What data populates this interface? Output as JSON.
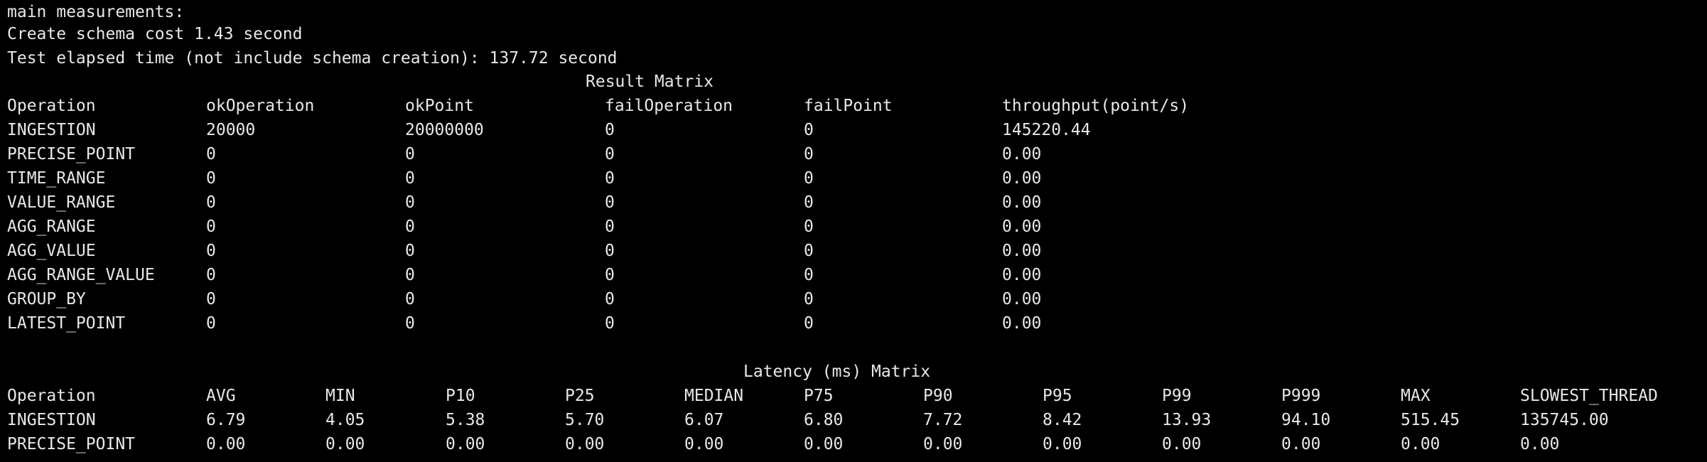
{
  "colors": {
    "background": "#000000",
    "text": "#e8e8e8"
  },
  "header": {
    "line1": "main measurements:",
    "line2": "Create schema cost 1.43 second",
    "line3": "Test elapsed time (not include schema creation): 137.72 second"
  },
  "result_matrix": {
    "title": "Result Matrix",
    "headers": [
      "Operation",
      "okOperation",
      "okPoint",
      "failOperation",
      "failPoint",
      "throughput(point/s)"
    ],
    "rows": [
      [
        "INGESTION",
        "20000",
        "20000000",
        "0",
        "0",
        "145220.44"
      ],
      [
        "PRECISE_POINT",
        "0",
        "0",
        "0",
        "0",
        "0.00"
      ],
      [
        "TIME_RANGE",
        "0",
        "0",
        "0",
        "0",
        "0.00"
      ],
      [
        "VALUE_RANGE",
        "0",
        "0",
        "0",
        "0",
        "0.00"
      ],
      [
        "AGG_RANGE",
        "0",
        "0",
        "0",
        "0",
        "0.00"
      ],
      [
        "AGG_VALUE",
        "0",
        "0",
        "0",
        "0",
        "0.00"
      ],
      [
        "AGG_RANGE_VALUE",
        "0",
        "0",
        "0",
        "0",
        "0.00"
      ],
      [
        "GROUP_BY",
        "0",
        "0",
        "0",
        "0",
        "0.00"
      ],
      [
        "LATEST_POINT",
        "0",
        "0",
        "0",
        "0",
        "0.00"
      ]
    ]
  },
  "latency_matrix": {
    "title": "Latency (ms) Matrix",
    "headers": [
      "Operation",
      "AVG",
      "MIN",
      "P10",
      "P25",
      "MEDIAN",
      "P75",
      "P90",
      "P95",
      "P99",
      "P999",
      "MAX",
      "SLOWEST_THREAD"
    ],
    "rows": [
      [
        "INGESTION",
        "6.79",
        "4.05",
        "5.38",
        "5.70",
        "6.07",
        "6.80",
        "7.72",
        "8.42",
        "13.93",
        "94.10",
        "515.45",
        "135745.00"
      ],
      [
        "PRECISE_POINT",
        "0.00",
        "0.00",
        "0.00",
        "0.00",
        "0.00",
        "0.00",
        "0.00",
        "0.00",
        "0.00",
        "0.00",
        "0.00",
        "0.00"
      ]
    ]
  }
}
